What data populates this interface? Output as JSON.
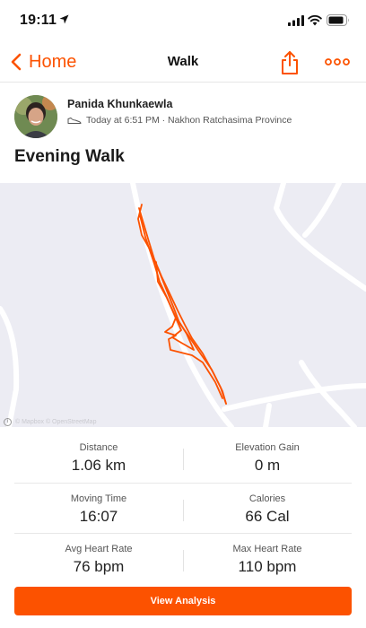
{
  "status_bar": {
    "time": "19:11"
  },
  "nav": {
    "back_label": "Home",
    "title": "Walk"
  },
  "activity": {
    "athlete_name": "Panida Khunkaewla",
    "meta": "Today at 6:51 PM · Nakhon Ratchasima Province",
    "title": "Evening Walk"
  },
  "map": {
    "attribution": "© Mapbox © OpenStreetMap"
  },
  "stats": {
    "distance_label": "Distance",
    "distance_value": "1.06 km",
    "elevation_label": "Elevation Gain",
    "elevation_value": "0 m",
    "moving_time_label": "Moving Time",
    "moving_time_value": "16:07",
    "calories_label": "Calories",
    "calories_value": "66 Cal",
    "avg_hr_label": "Avg Heart Rate",
    "avg_hr_value": "76 bpm",
    "max_hr_label": "Max Heart Rate",
    "max_hr_value": "110 bpm"
  },
  "actions": {
    "view_analysis_label": "View Analysis"
  },
  "colors": {
    "accent": "#fc5200",
    "route": "#fc5200",
    "map_bg": "#ececf3"
  },
  "icons": {
    "back": "chevron-left-icon",
    "share": "share-icon",
    "more": "more-icon",
    "shoe": "shoe-icon",
    "location": "location-arrow-icon"
  }
}
